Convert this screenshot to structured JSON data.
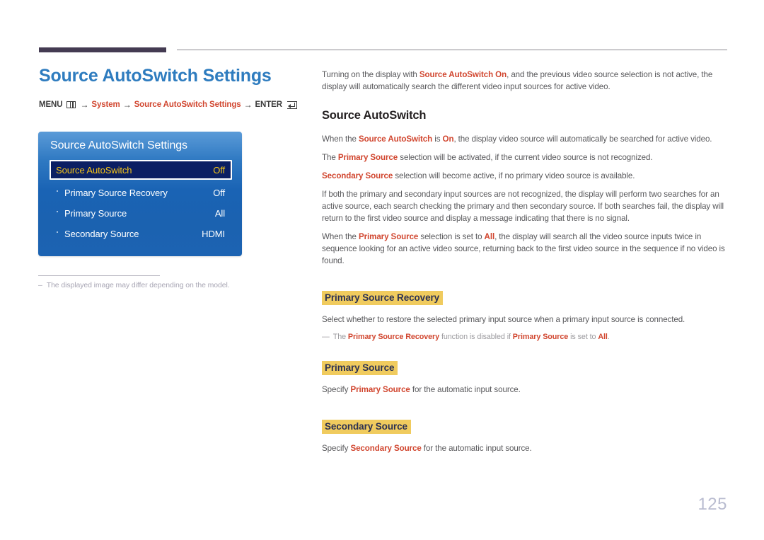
{
  "page": {
    "number": "125"
  },
  "left": {
    "title": "Source AutoSwitch Settings",
    "breadcrumb": {
      "menu_label": "MENU",
      "menu_icon": "menu-bars-icon",
      "arrow": "→",
      "step1": "System",
      "step2": "Source AutoSwitch Settings",
      "enter_label": "ENTER",
      "enter_icon": "enter-return-icon"
    },
    "osd": {
      "title": "Source AutoSwitch Settings",
      "rows": [
        {
          "label": "Source AutoSwitch",
          "value": "Off",
          "selected": true,
          "bullet": false
        },
        {
          "label": "Primary Source Recovery",
          "value": "Off",
          "selected": false,
          "bullet": true
        },
        {
          "label": "Primary Source",
          "value": "All",
          "selected": false,
          "bullet": true
        },
        {
          "label": "Secondary Source",
          "value": "HDMI",
          "selected": false,
          "bullet": true
        }
      ]
    },
    "image_note": {
      "dash": "–",
      "text": "The displayed image may differ depending on the model."
    }
  },
  "right": {
    "intro": {
      "p1_a": "Turning on the display with ",
      "p1_b": "Source AutoSwitch On",
      "p1_c": ", and the previous video source selection is not active, the display will automatically search the different video input sources for active video."
    },
    "section1": {
      "title": "Source AutoSwitch",
      "p1_a": "When the ",
      "p1_b": "Source AutoSwitch",
      "p1_c": " is ",
      "p1_d": "On",
      "p1_e": ", the display video source will automatically be searched for active video.",
      "p2_a": "The ",
      "p2_b": "Primary Source",
      "p2_c": " selection will be activated, if the current video source is not recognized.",
      "p3_a": "Secondary Source",
      "p3_b": " selection will become active, if no primary video source is available.",
      "p4": "If both the primary and secondary input sources are not recognized, the display will perform two searches for an active source, each search checking the primary and then secondary source. If both searches fail, the display will return to the first video source and display a message indicating that there is no signal.",
      "p5_a": "When the ",
      "p5_b": "Primary Source",
      "p5_c": " selection is set to ",
      "p5_d": "All",
      "p5_e": ", the display will search all the video source inputs twice in sequence looking for an active video source, returning back to the first video source in the sequence if no video is found."
    },
    "section2": {
      "title": "Primary Source Recovery",
      "p1": "Select whether to restore the selected primary input source when a primary input source is connected.",
      "note_dash": "—",
      "note_a": "The ",
      "note_b": "Primary Source Recovery",
      "note_c": " function is disabled if ",
      "note_d": "Primary Source",
      "note_e": " is set to ",
      "note_f": "All",
      "note_g": "."
    },
    "section3": {
      "title": "Primary Source",
      "p1_a": "Specify ",
      "p1_b": "Primary Source",
      "p1_c": " for the automatic input source."
    },
    "section4": {
      "title": "Secondary Source",
      "p1_a": "Specify ",
      "p1_b": "Secondary Source",
      "p1_c": " for the automatic input source."
    }
  },
  "colors": {
    "title_blue": "#2e7cbf",
    "accent_red": "#d1462f",
    "highlight_yellow": "#f0cb5e",
    "osd_blue": "#1a63b4",
    "osd_selected_navy": "#0b1f63",
    "osd_selected_text": "#f5c518",
    "rule_purple": "#443b52",
    "page_number_gray": "#b9bcd0"
  }
}
